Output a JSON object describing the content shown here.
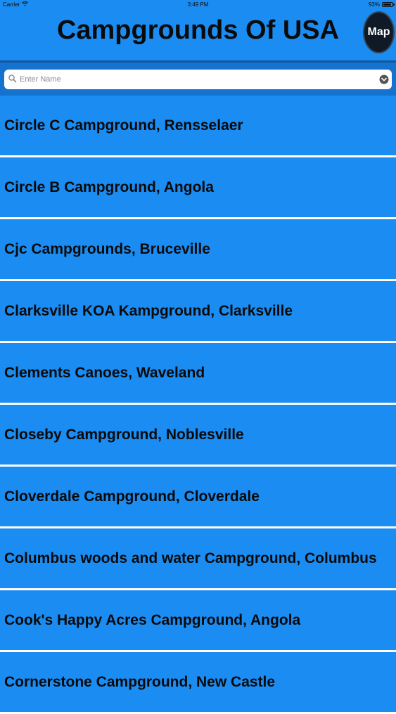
{
  "status_bar": {
    "carrier": "Carrier",
    "time": "3:49 PM",
    "battery_text": "93%",
    "battery_level": 0.93
  },
  "header": {
    "title": "Campgrounds Of USA",
    "map_button_label": "Map"
  },
  "search": {
    "placeholder": "Enter Name",
    "icon": "search-icon",
    "dropdown_icon": "chevron-down-circle-icon"
  },
  "list": {
    "items": [
      {
        "label": "Circle C Campground, Rensselaer"
      },
      {
        "label": "Circle B Campground, Angola"
      },
      {
        "label": "Cjc Campgrounds, Bruceville"
      },
      {
        "label": "Clarksville KOA Kampground, Clarksville"
      },
      {
        "label": "Clements Canoes, Waveland"
      },
      {
        "label": "Closeby Campground, Noblesville"
      },
      {
        "label": "Cloverdale Campground, Cloverdale"
      },
      {
        "label": "Columbus woods and water Campground, Columbus"
      },
      {
        "label": "Cook's Happy Acres Campground, Angola"
      },
      {
        "label": "Cornerstone Campground, New Castle"
      }
    ]
  },
  "colors": {
    "background": "#1b8cf2",
    "search_bar": "#1672cf",
    "separator": "#ffffff",
    "map_button": "#0f1a26"
  }
}
